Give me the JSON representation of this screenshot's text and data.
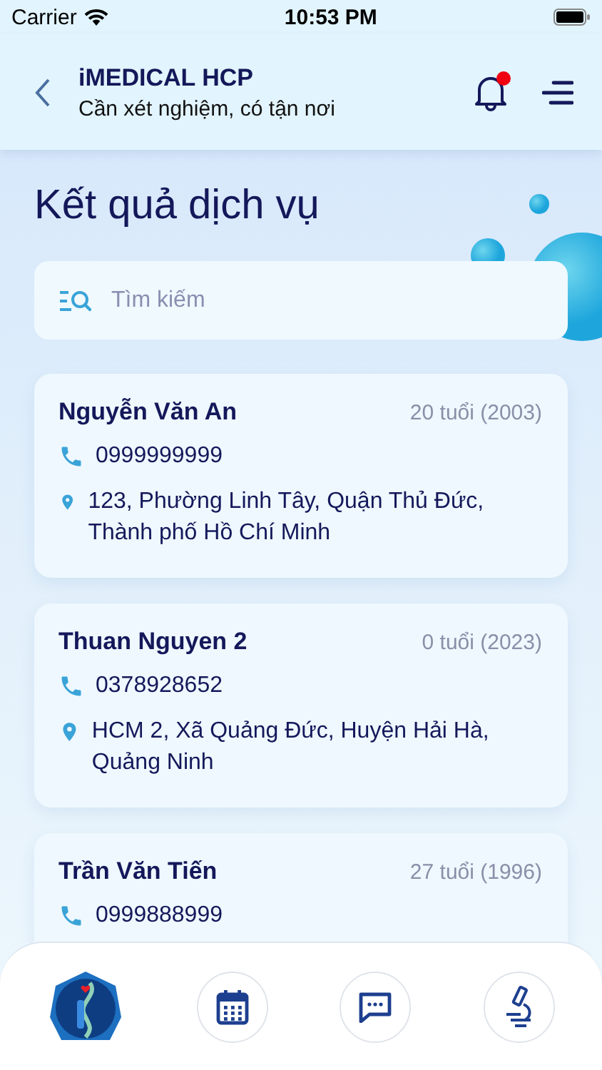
{
  "status_bar": {
    "carrier": "Carrier",
    "time": "10:53 PM"
  },
  "header": {
    "title": "iMEDICAL HCP",
    "subtitle": "Cần xét nghiệm, có tận nơi",
    "has_notification": true
  },
  "page_title": "Kết quả dịch vụ",
  "search": {
    "placeholder": "Tìm kiếm"
  },
  "patients": [
    {
      "name": "Nguyễn Văn An",
      "age": "20 tuổi (2003)",
      "phone": "0999999999",
      "address": "123, Phường Linh Tây, Quận Thủ Đức, Thành phố Hồ Chí Minh"
    },
    {
      "name": "Thuan Nguyen 2",
      "age": "0 tuổi (2023)",
      "phone": "0378928652",
      "address": "HCM 2, Xã Quảng Đức, Huyện Hải Hà, Quảng Ninh"
    },
    {
      "name": "Trần Văn Tiến",
      "age": "27 tuổi (1996)",
      "phone": "0999888999"
    }
  ],
  "bottom_nav": [
    {
      "kind": "logo"
    },
    {
      "kind": "calendar"
    },
    {
      "kind": "chat"
    },
    {
      "kind": "microscope"
    }
  ]
}
